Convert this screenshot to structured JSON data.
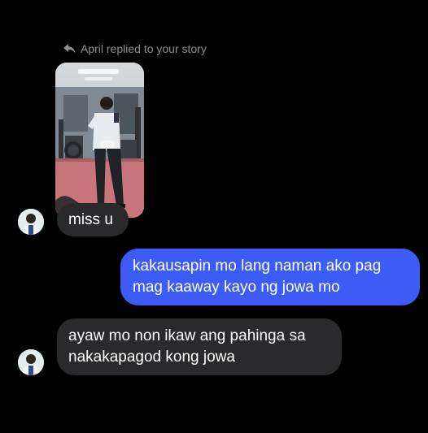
{
  "conversation": {
    "reply_notice": "April replied to your story",
    "messages": [
      {
        "sender": "April",
        "text": "miss u"
      },
      {
        "sender": "me",
        "line1": "kakausapin mo lang naman ako pag",
        "line2": "mag kaaway kayo ng jowa mo"
      },
      {
        "sender": "April",
        "line1": "ayaw mo non ikaw ang pahinga sa",
        "line2": "nakakapagod kong jowa"
      }
    ]
  },
  "colors": {
    "background": "#000000",
    "incoming_bubble": "#2a2a2c",
    "outgoing_bubble": "#3d5cf5",
    "muted_text": "#8e8e93"
  },
  "icons": {
    "reply": "reply-arrow-icon",
    "avatar": "profile-avatar"
  }
}
